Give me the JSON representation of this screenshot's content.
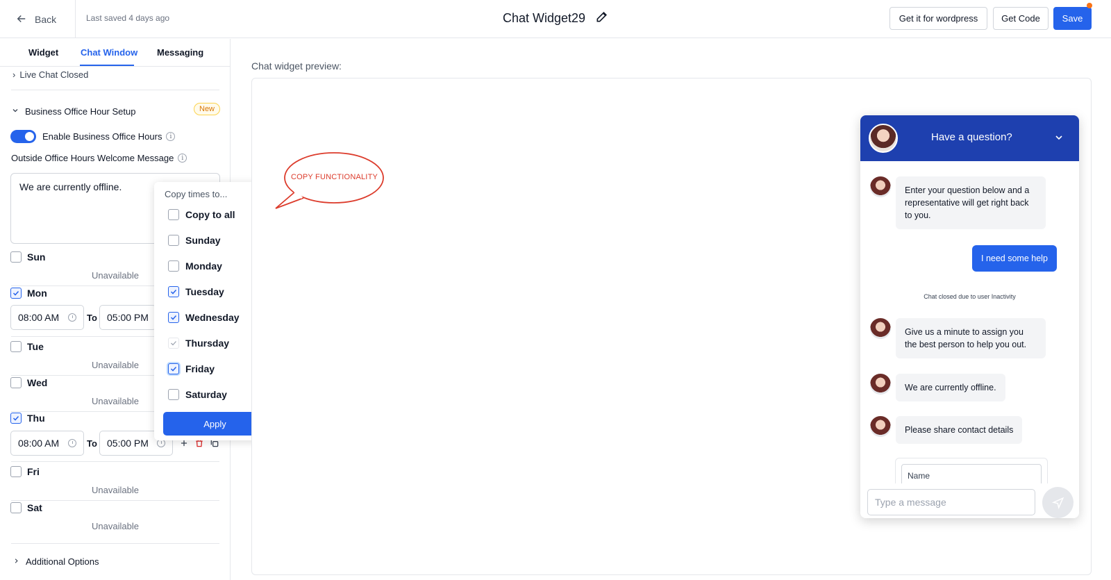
{
  "header": {
    "back_label": "Back",
    "saved_text": "Last saved 4 days ago",
    "title": "Chat Widget29",
    "wordpress_label": "Get it for wordpress",
    "get_code_label": "Get Code",
    "save_label": "Save"
  },
  "tabs": [
    {
      "label": "Widget"
    },
    {
      "label": "Chat Window"
    },
    {
      "label": "Messaging"
    }
  ],
  "active_tab": "Chat Window",
  "left": {
    "prev_section": "Live Chat Closed",
    "section_title": "Business Office Hour Setup",
    "badge": "New",
    "toggle_label": "Enable Business Office Hours",
    "toggle_on": true,
    "outside_label": "Outside Office Hours Welcome Message",
    "message_value": "We are currently offline.",
    "unavailable": "Unavailable",
    "to_label": "To",
    "days": [
      {
        "label": "Sun",
        "checked": false
      },
      {
        "label": "Mon",
        "checked": true,
        "from": "08:00 AM",
        "to": "05:00 PM"
      },
      {
        "label": "Tue",
        "checked": false
      },
      {
        "label": "Wed",
        "checked": false
      },
      {
        "label": "Thu",
        "checked": true,
        "from": "08:00 AM",
        "to": "05:00 PM"
      },
      {
        "label": "Fri",
        "checked": false
      },
      {
        "label": "Sat",
        "checked": false
      }
    ],
    "additional_options": "Additional Options"
  },
  "popup": {
    "title": "Copy times to...",
    "items": [
      {
        "label": "Copy to all",
        "state": "unchecked"
      },
      {
        "label": "Sunday",
        "state": "unchecked"
      },
      {
        "label": "Monday",
        "state": "unchecked"
      },
      {
        "label": "Tuesday",
        "state": "checked"
      },
      {
        "label": "Wednesday",
        "state": "checked"
      },
      {
        "label": "Thursday",
        "state": "disabled-checked"
      },
      {
        "label": "Friday",
        "state": "checked"
      },
      {
        "label": "Saturday",
        "state": "unchecked"
      }
    ],
    "apply_label": "Apply"
  },
  "preview": {
    "label": "Chat widget preview:",
    "callout": "COPY FUNCTIONALITY"
  },
  "chat": {
    "title": "Have a question?",
    "messages": [
      {
        "from": "agent",
        "text": "Enter your question below and a representative will get right back to you."
      },
      {
        "from": "user",
        "text": "I need some help"
      },
      {
        "from": "system",
        "text": "Chat closed due to user Inactivity"
      },
      {
        "from": "agent",
        "text": "Give us a minute to assign you the best person to help you out."
      },
      {
        "from": "agent",
        "text": "We are currently offline."
      },
      {
        "from": "agent",
        "text": "Please share contact details"
      }
    ],
    "name_placeholder": "Name",
    "input_placeholder": "Type a message"
  },
  "colors": {
    "accent": "#2563eb",
    "chat_header": "#1e40af",
    "callout": "#dc3b2b",
    "badge": "#d97706"
  }
}
